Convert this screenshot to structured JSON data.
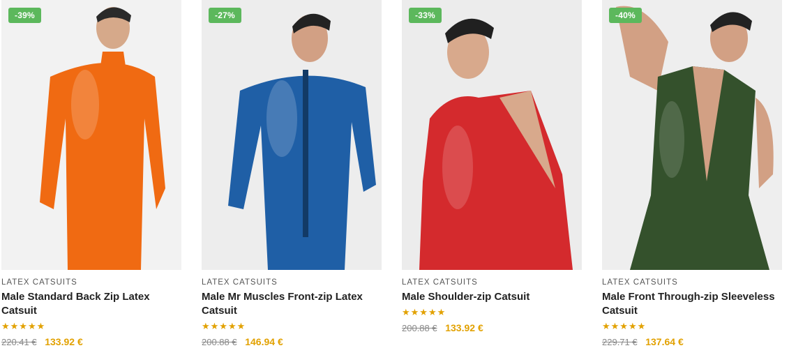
{
  "products": [
    {
      "discount": "-39%",
      "category": "LATEX CATSUITS",
      "title": "Male Standard Back Zip Latex Catsuit",
      "stars": "★★★★★",
      "rating": 5,
      "old_price": "220.41 €",
      "new_price": "133.92 €",
      "suit_color": "#f06a12",
      "bg_color": "#f2f2f2",
      "image_alt": "orange-latex-catsuit"
    },
    {
      "discount": "-27%",
      "category": "LATEX CATSUITS",
      "title": "Male Mr Muscles Front-zip Latex Catsuit",
      "stars": "★★★★★",
      "rating": 5,
      "old_price": "200.88 €",
      "new_price": "146.94 €",
      "suit_color": "#1f5fa6",
      "bg_color": "#ededed",
      "image_alt": "blue-latex-catsuit"
    },
    {
      "discount": "-33%",
      "category": "LATEX CATSUITS",
      "title": "Male Shoulder-zip Catsuit",
      "stars": "★★★★★",
      "rating": 5,
      "old_price": "200.88 €",
      "new_price": "133.92 €",
      "suit_color": "#d42a2d",
      "bg_color": "#ececec",
      "image_alt": "red-latex-catsuit"
    },
    {
      "discount": "-40%",
      "category": "LATEX CATSUITS",
      "title": "Male Front Through-zip Sleeveless Catsuit",
      "stars": "★★★★★",
      "rating": 4.5,
      "old_price": "229.71 €",
      "new_price": "137.64 €",
      "suit_color": "#34512c",
      "bg_color": "#eeeeee",
      "image_alt": "green-latex-catsuit"
    }
  ]
}
